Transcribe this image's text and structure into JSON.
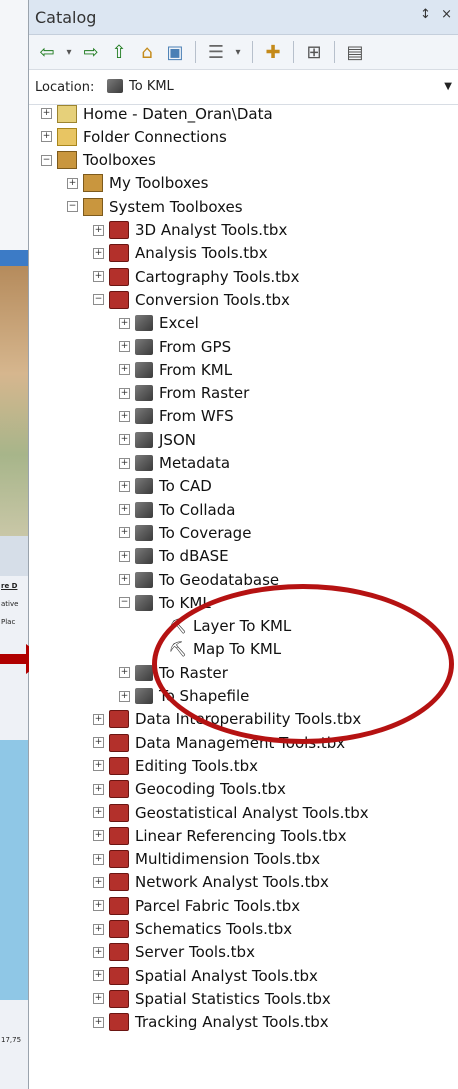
{
  "window": {
    "title": "Catalog",
    "pin": "↕",
    "close": "×"
  },
  "toolbar": {
    "icons": [
      "back-arrow",
      "forward-arrow",
      "up-folder",
      "home",
      "connect-folder",
      "view-options",
      "new-item",
      "toc-connect",
      "details-view"
    ]
  },
  "location": {
    "label": "Location:",
    "value": "To KML"
  },
  "left_strip": {
    "texts": [
      "re D",
      "ative",
      "Plac",
      "17,75"
    ]
  },
  "tree": [
    {
      "label": "Home - Daten_Oran\\Data",
      "expand": "+",
      "icon": "home"
    },
    {
      "label": "Folder Connections",
      "expand": "+",
      "icon": "folder"
    },
    {
      "label": "Toolboxes",
      "expand": "−",
      "icon": "toolboxes"
    },
    {
      "label": "My Toolboxes",
      "expand": "+",
      "icon": "toolboxes"
    },
    {
      "label": "System Toolboxes",
      "expand": "−",
      "icon": "toolboxes"
    },
    {
      "label": "3D Analyst Tools.tbx",
      "expand": "+",
      "icon": "tbx"
    },
    {
      "label": "Analysis Tools.tbx",
      "expand": "+",
      "icon": "tbx"
    },
    {
      "label": "Cartography Tools.tbx",
      "expand": "+",
      "icon": "tbx"
    },
    {
      "label": "Conversion Tools.tbx",
      "expand": "−",
      "icon": "tbx"
    },
    {
      "label": "Excel",
      "expand": "+",
      "icon": "set"
    },
    {
      "label": "From GPS",
      "expand": "+",
      "icon": "set"
    },
    {
      "label": "From KML",
      "expand": "+",
      "icon": "set"
    },
    {
      "label": "From Raster",
      "expand": "+",
      "icon": "set"
    },
    {
      "label": "From WFS",
      "expand": "+",
      "icon": "set"
    },
    {
      "label": "JSON",
      "expand": "+",
      "icon": "set"
    },
    {
      "label": "Metadata",
      "expand": "+",
      "icon": "set"
    },
    {
      "label": "To CAD",
      "expand": "+",
      "icon": "set"
    },
    {
      "label": "To Collada",
      "expand": "+",
      "icon": "set"
    },
    {
      "label": "To Coverage",
      "expand": "+",
      "icon": "set"
    },
    {
      "label": "To dBASE",
      "expand": "+",
      "icon": "set"
    },
    {
      "label": "To Geodatabase",
      "expand": "+",
      "icon": "set"
    },
    {
      "label": "To KML",
      "expand": "−",
      "icon": "set"
    },
    {
      "label": "Layer To KML",
      "expand": "",
      "icon": "tool"
    },
    {
      "label": "Map To KML",
      "expand": "",
      "icon": "tool"
    },
    {
      "label": "To Raster",
      "expand": "+",
      "icon": "set"
    },
    {
      "label": "To Shapefile",
      "expand": "+",
      "icon": "set"
    },
    {
      "label": "Data Interoperability Tools.tbx",
      "expand": "+",
      "icon": "tbx"
    },
    {
      "label": "Data Management Tools.tbx",
      "expand": "+",
      "icon": "tbx"
    },
    {
      "label": "Editing Tools.tbx",
      "expand": "+",
      "icon": "tbx"
    },
    {
      "label": "Geocoding Tools.tbx",
      "expand": "+",
      "icon": "tbx"
    },
    {
      "label": "Geostatistical Analyst Tools.tbx",
      "expand": "+",
      "icon": "tbx"
    },
    {
      "label": "Linear Referencing Tools.tbx",
      "expand": "+",
      "icon": "tbx"
    },
    {
      "label": "Multidimension Tools.tbx",
      "expand": "+",
      "icon": "tbx"
    },
    {
      "label": "Network Analyst Tools.tbx",
      "expand": "+",
      "icon": "tbx"
    },
    {
      "label": "Parcel Fabric Tools.tbx",
      "expand": "+",
      "icon": "tbx"
    },
    {
      "label": "Schematics Tools.tbx",
      "expand": "+",
      "icon": "tbx"
    },
    {
      "label": "Server Tools.tbx",
      "expand": "+",
      "icon": "tbx"
    },
    {
      "label": "Spatial Analyst Tools.tbx",
      "expand": "+",
      "icon": "tbx"
    },
    {
      "label": "Spatial Statistics Tools.tbx",
      "expand": "+",
      "icon": "tbx"
    },
    {
      "label": "Tracking Analyst Tools.tbx",
      "expand": "+",
      "icon": "tbx"
    }
  ]
}
